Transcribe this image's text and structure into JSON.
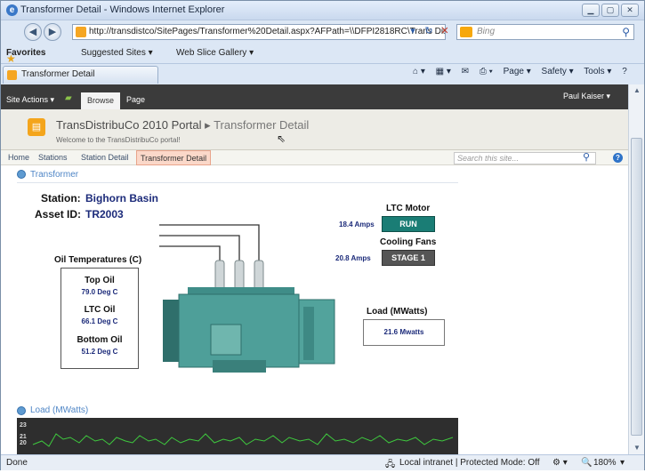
{
  "window": {
    "title": "Transformer Detail - Windows Internet Explorer"
  },
  "address": {
    "url": "http://transdistco/SitePages/Transformer%20Detail.aspx?AFPath=\\\\DFPI2818RC\\Trans DistribuCo\\1",
    "search_placeholder": "Bing"
  },
  "favorites": {
    "label": "Favorites",
    "suggested": "Suggested Sites ▾",
    "webslice": "Web Slice Gallery ▾"
  },
  "tab": {
    "label": "Transformer Detail"
  },
  "commands": [
    "Page ▾",
    "Safety ▾",
    "Tools ▾"
  ],
  "sp": {
    "site_actions": "Site Actions ▾",
    "browse": "Browse",
    "page": "Page",
    "user": "Paul Kaiser ▾",
    "site_title": "TransDistribuCo 2010 Portal",
    "page_title": "Transformer Detail",
    "welcome": "Welcome to the TransDistribuCo portal!",
    "nav": [
      "Home",
      "Stations",
      "Station Detail",
      "Transformer Detail"
    ],
    "search_placeholder": "Search this site..."
  },
  "transformer": {
    "section_title": "Transformer",
    "station_label": "Station:",
    "station_value": "Bighorn Basin",
    "asset_label": "Asset ID:",
    "asset_value": "TR2003",
    "ltc_motor_label": "LTC Motor",
    "ltc_amps": "18.4 Amps",
    "ltc_status": "RUN",
    "cooling_label": "Cooling Fans",
    "cooling_amps": "20.8 Amps",
    "cooling_status": "STAGE 1",
    "oil_title": "Oil Temperatures (C)",
    "top_oil_label": "Top Oil",
    "top_oil_value": "79.0 Deg C",
    "ltc_oil_label": "LTC Oil",
    "ltc_oil_value": "66.1 Deg C",
    "bottom_oil_label": "Bottom Oil",
    "bottom_oil_value": "51.2 Deg C",
    "load_title": "Load (MWatts)",
    "load_value": "21.6 Mwatts"
  },
  "load_section": {
    "title": "Load (MWatts)",
    "axis_ticks": [
      "23",
      "21",
      "20"
    ]
  },
  "status": {
    "left": "Done",
    "zone": "Local intranet | Protected Mode: Off",
    "zoom": "180%"
  }
}
